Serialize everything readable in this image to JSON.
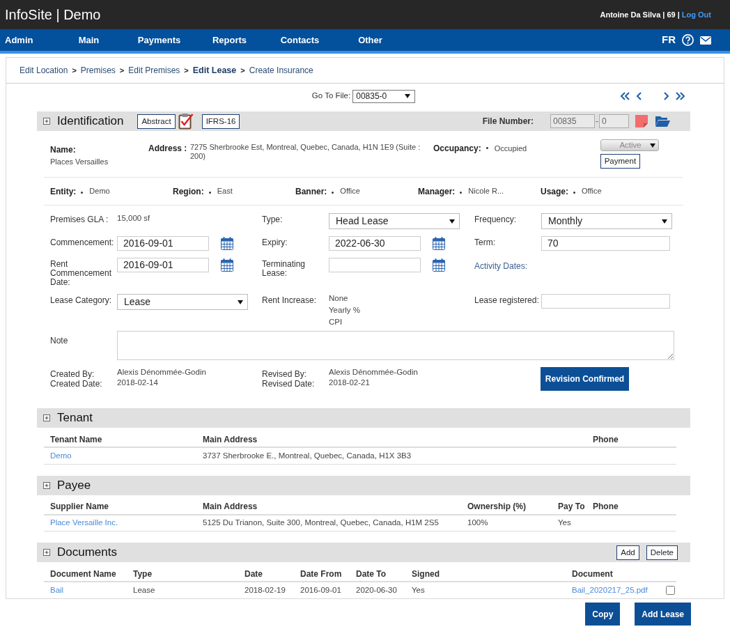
{
  "header": {
    "title": "InfoSite | Demo",
    "user": "Antoine Da Silva | 69 |",
    "logout": "Log Out"
  },
  "nav": {
    "items": [
      "Admin",
      "Main",
      "Payments",
      "Reports",
      "Contacts",
      "Other"
    ],
    "language": "FR"
  },
  "breadcrumb": [
    {
      "label": "Edit Location",
      "current": false,
      "separator": ">"
    },
    {
      "label": "Premises",
      "current": false,
      "separator": ">"
    },
    {
      "label": "Edit Premises",
      "current": false,
      "separator": ">"
    },
    {
      "label": "Edit Lease",
      "current": true,
      "separator": ">"
    },
    {
      "label": "Create Insurance",
      "current": false
    }
  ],
  "go_to_file": {
    "label": "Go To File:",
    "value": "00835-0"
  },
  "identification": {
    "title": "Identification",
    "buttons": [
      "Abstract",
      "IFRS-16"
    ],
    "file_number": {
      "label": "File Number:",
      "value": "00835",
      "separator": "-",
      "suffix": "0",
      "disabled": true
    },
    "name": {
      "label": "Name:",
      "value": "Places Versailles"
    },
    "address": {
      "label": "Address :",
      "value": "7275 Sherbrooke Est, Montreal, Quebec, Canada, H1N 1E9 (Suite : 200)"
    },
    "occupancy": {
      "label": "Occupancy:",
      "value": "Occupied"
    },
    "status": {
      "value": "Active",
      "disabled": true
    },
    "payment_button": "Payment",
    "attributes": [
      {
        "label": "Entity:",
        "value": "Demo"
      },
      {
        "label": "Region:",
        "value": "East"
      },
      {
        "label": "Banner:",
        "value": "Office"
      },
      {
        "label": "Manager:",
        "value": "Nicole R..."
      },
      {
        "label": "Usage:",
        "value": "Office"
      }
    ],
    "fields": [
      {
        "cells": [
          {
            "kind": "text",
            "label": "Premises GLA :",
            "value": "15,000 sf"
          },
          {
            "kind": "select",
            "label": "Type:",
            "value": "Head Lease"
          },
          {
            "kind": "select",
            "label": "Frequency:",
            "value": "Monthly"
          }
        ]
      },
      {
        "cells": [
          {
            "kind": "date",
            "label": "Commencement:",
            "value": "2016-09-01"
          },
          {
            "kind": "date",
            "label": "Expiry:",
            "value": "2022-06-30"
          },
          {
            "kind": "input",
            "label": "Term:",
            "value": "70"
          }
        ]
      },
      {
        "cells": [
          {
            "kind": "date",
            "label": "Rent Commencement Date:",
            "value": "2016-09-01"
          },
          {
            "kind": "date",
            "label": "Terminating Lease:"
          },
          {
            "kind": "link",
            "label": "Activity Dates:"
          }
        ]
      },
      {
        "cells": [
          {
            "kind": "select",
            "label": "Lease Category:",
            "value": "Lease"
          },
          {
            "kind": "list",
            "label": "Rent Increase:",
            "options": [
              "None",
              "Yearly %",
              "CPI"
            ]
          },
          {
            "kind": "input",
            "label": "Lease registered:"
          }
        ]
      }
    ],
    "note": {
      "label": "Note"
    },
    "created": {
      "by_label": "Created By:",
      "date_label": "Created Date:",
      "by": "Alexis Dénommée-Godin",
      "date": "2018-02-14"
    },
    "revised": {
      "by_label": "Revised By:",
      "date_label": "Revised Date:",
      "by": "Alexis Dénommée-Godin",
      "date": "2018-02-21"
    },
    "confirm_button": "Revision Confirmed"
  },
  "tenant": {
    "title": "Tenant",
    "columns": [
      {
        "label": "Tenant Name",
        "kind": "link"
      },
      {
        "label": "Main Address",
        "kind": "text"
      },
      {
        "label": "Phone",
        "kind": "text"
      }
    ],
    "rows": [
      {
        "cells": [
          "Demo",
          "3737 Sherbrooke E., Montreal, Quebec, Canada, H1X 3B3"
        ]
      }
    ]
  },
  "payee": {
    "title": "Payee",
    "columns": [
      {
        "label": "Supplier Name",
        "kind": "link"
      },
      {
        "label": "Main Address",
        "kind": "text"
      },
      {
        "label": "Ownership (%)",
        "kind": "text"
      },
      {
        "label": "Pay To",
        "kind": "text"
      },
      {
        "label": "Phone",
        "kind": "text"
      }
    ],
    "rows": [
      {
        "cells": [
          "Place Versaille Inc.",
          "5125 Du Trianon, Suite 300, Montreal, Quebec, Canada, H1M 2S5",
          "100%",
          "Yes"
        ]
      }
    ]
  },
  "documents": {
    "title": "Documents",
    "buttons": [
      "Add",
      "Delete"
    ],
    "columns": [
      {
        "label": "Document Name",
        "kind": "link"
      },
      {
        "label": "Type",
        "kind": "text"
      },
      {
        "label": "Date",
        "kind": "text"
      },
      {
        "label": "Date From",
        "kind": "text"
      },
      {
        "label": "Date To",
        "kind": "text"
      },
      {
        "label": "Signed",
        "kind": "text"
      },
      {
        "label": "Document",
        "kind": "link"
      },
      {
        "kind": "checkbox"
      }
    ],
    "rows": [
      {
        "cells": [
          "Bail",
          "Lease",
          "2018-02-19",
          "2016-09-01",
          "2020-06-30",
          "Yes",
          "Bail_2020217_25.pdf"
        ],
        "checked": false
      }
    ]
  },
  "footer_buttons": [
    "Copy",
    "Add Lease"
  ]
}
